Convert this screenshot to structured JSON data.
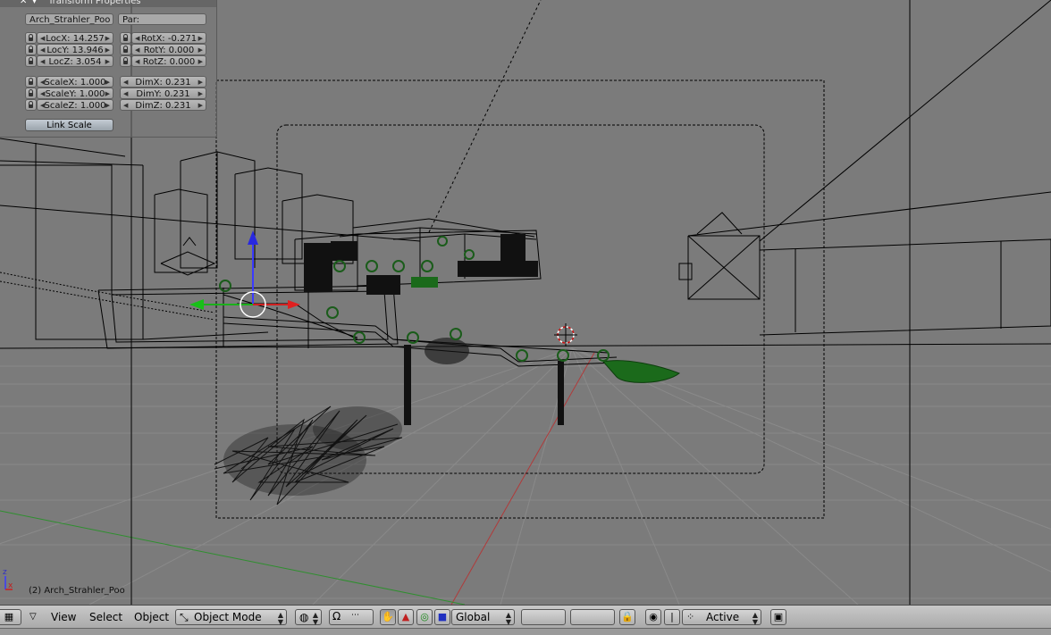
{
  "panel": {
    "title": "Transform Properties",
    "object_name": "Arch_Strahler_Poo",
    "parent_label": "Par:",
    "loc": [
      "LocX: 14.257",
      "LocY: 13.946",
      "LocZ: 3.054"
    ],
    "rot": [
      "RotX: -0.271",
      "RotY: 0.000",
      "RotZ: 0.000"
    ],
    "scale": [
      "ScaleX: 1.000",
      "ScaleY: 1.000",
      "ScaleZ: 1.000"
    ],
    "dim": [
      "DimX: 0.231",
      "DimY: 0.231",
      "DimZ: 0.231"
    ],
    "link_scale": "Link Scale"
  },
  "viewport": {
    "status": "(2) Arch_Strahler_Poo",
    "axis_labels": {
      "x": "x",
      "z": "z"
    },
    "colors": {
      "background": "#7b7b7b",
      "grid": "#8a8a8a",
      "wire": "#000000",
      "selected": "#1c6b1c"
    }
  },
  "header": {
    "menus": [
      "View",
      "Select",
      "Object"
    ],
    "mode": "Object Mode",
    "orientation": "Global",
    "pivot": "Active"
  }
}
